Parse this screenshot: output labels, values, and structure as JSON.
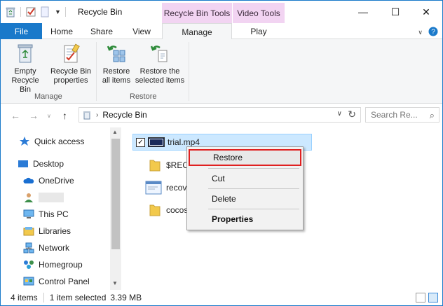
{
  "window": {
    "title": "Recycle Bin",
    "controls": {
      "minimize": "—",
      "maximize": "☐",
      "close": "✕"
    }
  },
  "context_headers": {
    "recycle_bin_tools": "Recycle Bin Tools",
    "video_tools": "Video Tools"
  },
  "tabs": {
    "file": "File",
    "home": "Home",
    "share": "Share",
    "view": "View",
    "manage": "Manage",
    "play": "Play"
  },
  "ribbon": {
    "empty_line1": "Empty",
    "empty_line2": "Recycle Bin",
    "props_line1": "Recycle Bin",
    "props_line2": "properties",
    "restore_all_line1": "Restore",
    "restore_all_line2": "all items",
    "restore_sel_line1": "Restore the",
    "restore_sel_line2": "selected items",
    "group_manage": "Manage",
    "group_restore": "Restore"
  },
  "address": {
    "path": "Recycle Bin",
    "search_placeholder": "Search Re..."
  },
  "nav_pane": {
    "quick_access": "Quick access",
    "desktop": "Desktop",
    "onedrive": "OneDrive",
    "this_pc": "This PC",
    "libraries": "Libraries",
    "network": "Network",
    "homegroup": "Homegroup",
    "control_panel": "Control Panel"
  },
  "files": [
    {
      "name": "trial.mp4"
    },
    {
      "name": "$REC"
    },
    {
      "name": "recov"
    },
    {
      "name": "cocos"
    }
  ],
  "context_menu": {
    "restore": "Restore",
    "cut": "Cut",
    "delete": "Delete",
    "properties": "Properties"
  },
  "status": {
    "count": "4 items",
    "selected": "1 item selected",
    "size": "3.39 MB"
  },
  "colors": {
    "accent": "#1979ca",
    "context_tab": "#f2d4f2",
    "selection": "#cce8ff",
    "highlight_border": "#e02020"
  }
}
